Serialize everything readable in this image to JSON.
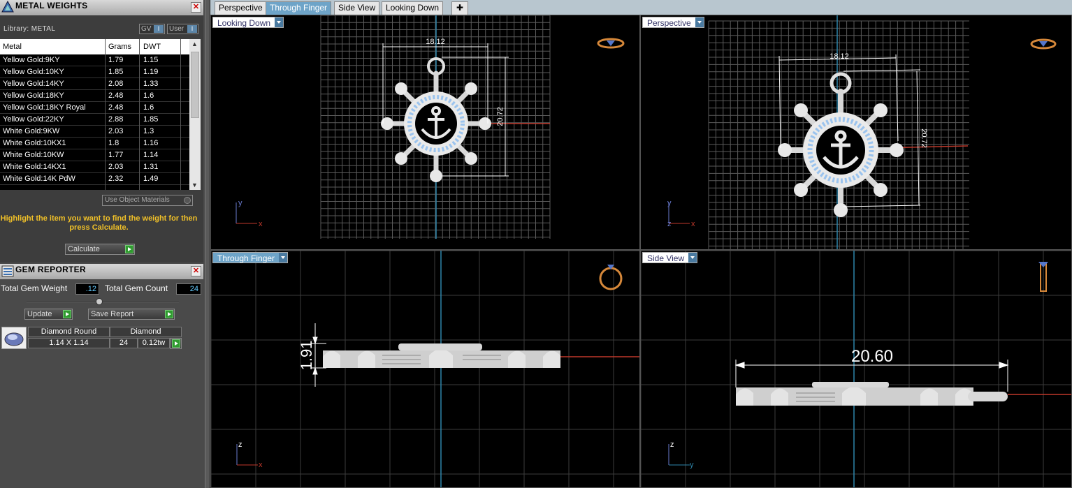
{
  "metal_weights": {
    "title": "METAL WEIGHTS",
    "library_label": "Library: METAL",
    "toggle_gv": "GV",
    "toggle_user": "User",
    "columns": [
      "Metal",
      "Grams",
      "DWT"
    ],
    "rows": [
      {
        "metal": "Yellow Gold:9KY",
        "grams": "1.79",
        "dwt": "1.15"
      },
      {
        "metal": "Yellow Gold:10KY",
        "grams": "1.85",
        "dwt": "1.19"
      },
      {
        "metal": "Yellow Gold:14KY",
        "grams": "2.08",
        "dwt": "1.33"
      },
      {
        "metal": "Yellow Gold:18KY",
        "grams": "2.48",
        "dwt": "1.6"
      },
      {
        "metal": "Yellow Gold:18KY Royal",
        "grams": "2.48",
        "dwt": "1.6"
      },
      {
        "metal": "Yellow Gold:22KY",
        "grams": "2.88",
        "dwt": "1.85"
      },
      {
        "metal": "White Gold:9KW",
        "grams": "2.03",
        "dwt": "1.3"
      },
      {
        "metal": "White Gold:10KX1",
        "grams": "1.8",
        "dwt": "1.16"
      },
      {
        "metal": "White Gold:10KW",
        "grams": "1.77",
        "dwt": "1.14"
      },
      {
        "metal": "White Gold:14KX1",
        "grams": "2.03",
        "dwt": "1.31"
      },
      {
        "metal": "White Gold:14K PdW",
        "grams": "2.32",
        "dwt": "1.49"
      }
    ],
    "use_object_materials": "Use Object Materials",
    "hint": "Highlight the item you want to find the weight for then press Calculate.",
    "calculate_label": "Calculate"
  },
  "gem_reporter": {
    "title": "GEM REPORTER",
    "total_weight_label": "Total Gem Weight",
    "total_weight_value": ".12",
    "total_count_label": "Total Gem Count",
    "total_count_value": "24",
    "update_label": "Update",
    "save_report_label": "Save Report",
    "gem": {
      "shape": "Diamond Round",
      "type": "Diamond",
      "size": "1.14 X 1.14",
      "count": "24",
      "weight": "0.12tw"
    }
  },
  "tabs": [
    "Perspective",
    "Through Finger",
    "Side View",
    "Looking Down"
  ],
  "active_tab": "Through Finger",
  "viewports": {
    "top_left": {
      "label": "Looking Down",
      "dim_width": "18.12",
      "dim_height": "20.72"
    },
    "top_right": {
      "label": "Perspective",
      "dim_width": "18.12",
      "dim_height": "20.72"
    },
    "bottom_left": {
      "label": "Through Finger",
      "dim_thickness": "1.91"
    },
    "bottom_right": {
      "label": "Side View",
      "dim_length": "20.60"
    }
  },
  "colors": {
    "accent": "#6ea4c8",
    "hint": "#f0c028",
    "axis_red": "#c0392b",
    "axis_blue": "#2e86ab"
  }
}
